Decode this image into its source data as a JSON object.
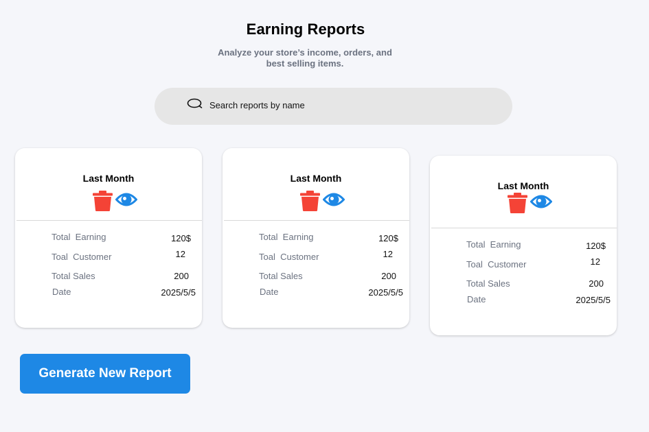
{
  "header": {
    "title": "Earning Reports",
    "subtitle_line1": "Analyze your store’s income, orders, and",
    "subtitle_line2": "best selling items."
  },
  "search": {
    "placeholder": "Search reports by name",
    "icon": "search-icon"
  },
  "labels": {
    "total_earning": "Total  Earning",
    "total_customer": "Toal  Customer",
    "total_sales": "Total Sales",
    "date": "Date"
  },
  "cards": [
    {
      "title": "Last Month",
      "total_earning": "120$",
      "total_customer": "12",
      "total_sales": "200",
      "date": "2025/5/5"
    },
    {
      "title": "Last Month",
      "total_earning": "120$",
      "total_customer": "12",
      "total_sales": "200",
      "date": "2025/5/5"
    },
    {
      "title": "Last Month",
      "total_earning": "120$",
      "total_customer": "12",
      "total_sales": "200",
      "date": "2025/5/5"
    }
  ],
  "icons": {
    "delete": "trash-icon",
    "view": "eye-icon"
  },
  "colors": {
    "background": "#f5f6fa",
    "delete_red": "#f44336",
    "view_blue": "#1e88e5",
    "button_blue": "#1e88e5",
    "subtitle_gray": "#6b7280"
  },
  "actions": {
    "generate_label": "Generate New Report"
  }
}
